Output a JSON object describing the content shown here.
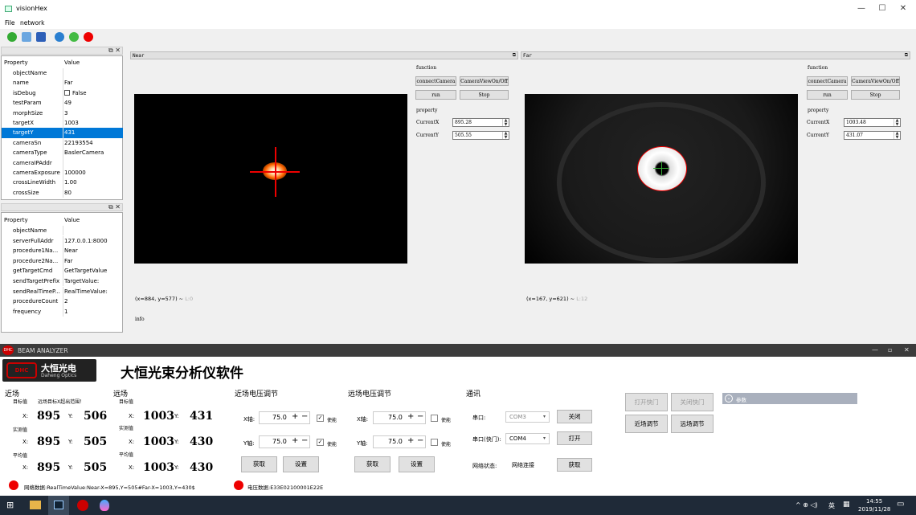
{
  "window1": {
    "title": "visionHex",
    "menu": [
      "File",
      "network"
    ],
    "controls": {
      "min": "—",
      "max": "☐",
      "close": "✕"
    }
  },
  "props1": {
    "header": {
      "k": "Property",
      "v": "Value"
    },
    "rows": [
      {
        "k": "objectName",
        "v": "",
        "selected": false
      },
      {
        "k": "name",
        "v": "Far",
        "selected": false
      },
      {
        "k": "isDebug",
        "v": "False",
        "checkbox": true,
        "selected": false
      },
      {
        "k": "testParam",
        "v": "49",
        "selected": false
      },
      {
        "k": "morphSize",
        "v": "3",
        "selected": false
      },
      {
        "k": "targetX",
        "v": "1003",
        "selected": false
      },
      {
        "k": "targetY",
        "v": "431",
        "selected": true
      },
      {
        "k": "cameraSn",
        "v": "22193554",
        "selected": false
      },
      {
        "k": "cameraType",
        "v": "BaslerCamera",
        "selected": false
      },
      {
        "k": "cameraIPAddr",
        "v": "",
        "selected": false
      },
      {
        "k": "cameraExposure",
        "v": "100000",
        "selected": false
      },
      {
        "k": "crossLineWidth",
        "v": "1.00",
        "selected": false
      },
      {
        "k": "crossSize",
        "v": "80",
        "selected": false
      }
    ]
  },
  "props2": {
    "header": {
      "k": "Property",
      "v": "Value"
    },
    "rows": [
      {
        "k": "objectName",
        "v": ""
      },
      {
        "k": "serverFullAddr",
        "v": "127.0.0.1:8000"
      },
      {
        "k": "procedure1Na...",
        "v": "Near"
      },
      {
        "k": "procedure2Na...",
        "v": "Far"
      },
      {
        "k": "getTargetCmd",
        "v": "GetTargetValue"
      },
      {
        "k": "sendTargetPrefix",
        "v": "TargetValue:"
      },
      {
        "k": "sendRealTimeP...",
        "v": "RealTimeValue:"
      },
      {
        "k": "procedureCount",
        "v": "2"
      },
      {
        "k": "frequency",
        "v": "1"
      }
    ]
  },
  "near": {
    "title": "Near",
    "function_label": "function",
    "btn_connect": "connectCamera",
    "btn_view": "CameraViewOn/Off",
    "btn_run": "run",
    "btn_stop": "Stop",
    "property_label": "property",
    "currentX_label": "CurrentX",
    "currentX": "895.28",
    "currentY_label": "CurrentY",
    "currentY": "505.55",
    "coords": "(x=884, y=577) ~ ",
    "level": "L:0",
    "info": "info"
  },
  "far": {
    "title": "Far",
    "function_label": "function",
    "btn_connect": "connectCamera",
    "btn_view": "CameraViewOn/Off",
    "btn_run": "run",
    "btn_stop": "Stop",
    "property_label": "property",
    "currentX_label": "CurrentX",
    "currentX": "1003.48",
    "currentY_label": "CurrentY",
    "currentY": "431.07",
    "coords": "(x=167, y=621) ~ ",
    "level": "L:12"
  },
  "window2": {
    "title": "BEAM ANALYZER",
    "logo_cn": "大恒光电",
    "logo_en": "Daheng Optics",
    "app_title": "大恒光束分析仪软件",
    "near_field": {
      "title": "近场",
      "target_label": "目标值",
      "warning": "远场目标X超出范围！",
      "measured_label": "实测值",
      "avg_label": "平均值",
      "target": {
        "x": "895",
        "y": "506"
      },
      "measured": {
        "x": "895",
        "y": "505"
      },
      "avg": {
        "x": "895",
        "y": "505"
      }
    },
    "far_field": {
      "title": "远场",
      "target_label": "目标值",
      "measured_label": "实测值",
      "avg_label": "平均值",
      "target": {
        "x": "1003",
        "y": "431"
      },
      "measured": {
        "x": "1003",
        "y": "430"
      },
      "avg": {
        "x": "1003",
        "y": "430"
      }
    },
    "x_label": "X:",
    "y_label": "Y:",
    "near_voltage": {
      "title": "近场电压调节",
      "x_axis": "X轴:",
      "x_val": "75.0",
      "y_axis": "Y轴:",
      "y_val": "75.0",
      "enable": "使能",
      "btn_get": "获取",
      "btn_set": "设置"
    },
    "far_voltage": {
      "title": "远场电压调节",
      "x_axis": "X轴:",
      "x_val": "75.0",
      "y_axis": "Y轴:",
      "y_val": "75.0",
      "enable": "使能",
      "btn_get": "获取",
      "btn_set": "设置"
    },
    "comm": {
      "title": "通讯",
      "port_label": "串口:",
      "port_val": "COM3",
      "btn_close": "关闭",
      "shutter_label": "串口(快门):",
      "shutter_val": "COM4",
      "btn_open": "打开",
      "net_label": "网络状态:",
      "net_val": "网络连接",
      "btn_get": "获取"
    },
    "shutter": {
      "open": "打开快门",
      "close": "关闭快门",
      "near_adjust": "近场调节",
      "far_adjust": "远场调节"
    },
    "params_label": "参数",
    "status_net": "网络数据:RealTimeValue:Near-X=895,Y=505#Far-X=1003,Y=430$",
    "status_volt": "电压数据:E33E02100001E22E"
  },
  "taskbar": {
    "time": "14:55",
    "date": "2019/11/28",
    "lang": "英",
    "tray": "^ ⊕ ◁) "
  },
  "colors": {
    "selection": "#0078d7",
    "crosshair": "#e00000",
    "status_dot": "#e00000"
  }
}
